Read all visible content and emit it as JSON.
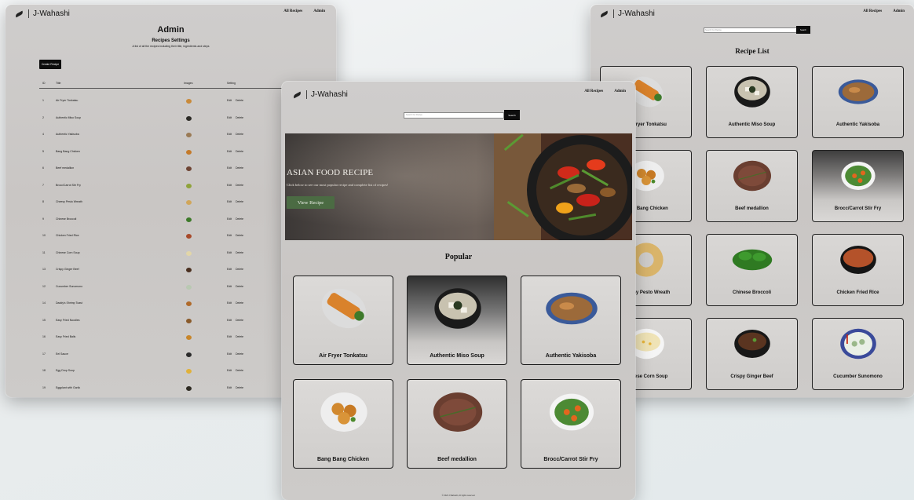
{
  "brand": "J-Wahashi",
  "nav": {
    "all_recipes": "All Recipes",
    "admin": "Admin"
  },
  "admin": {
    "title": "Admin",
    "subtitle": "Recipes Settings",
    "description": "A list of all the recipes including their title, ingredients and steps",
    "create_button": "Create Recipe",
    "columns": {
      "id": "ID",
      "title": "Title",
      "images": "Images",
      "setting": "Setting"
    },
    "edit_label": "Edit",
    "delete_label": "Delete",
    "rows": [
      {
        "id": "1",
        "title": "Air Fryer Tonkatsu",
        "thumb_color": "#c98a3a"
      },
      {
        "id": "2",
        "title": "Authentic Miso Soup",
        "thumb_color": "#2c2a26"
      },
      {
        "id": "4",
        "title": "Authentic Yakisoba",
        "thumb_color": "#9a7a55"
      },
      {
        "id": "5",
        "title": "Bang Bang Chicken",
        "thumb_color": "#c47a2a"
      },
      {
        "id": "6",
        "title": "Beef medallion",
        "thumb_color": "#6e4434"
      },
      {
        "id": "7",
        "title": "Brocc/Carrot Stir Fry",
        "thumb_color": "#8fa33a"
      },
      {
        "id": "8",
        "title": "Cheesy Pesto Wreath",
        "thumb_color": "#d1a65a"
      },
      {
        "id": "9",
        "title": "Chinese Broccoli",
        "thumb_color": "#3d7a2a"
      },
      {
        "id": "10",
        "title": "Chicken Fried Rice",
        "thumb_color": "#a84a2a"
      },
      {
        "id": "11",
        "title": "Chinese Corn Soup",
        "thumb_color": "#e2d6a8"
      },
      {
        "id": "13",
        "title": "Crispy Ginger Beef",
        "thumb_color": "#4a3020"
      },
      {
        "id": "12",
        "title": "Cucumber Sunomono",
        "thumb_color": "#b9c9b2"
      },
      {
        "id": "14",
        "title": "Daddy's Shrimp Toast",
        "thumb_color": "#b06a2a"
      },
      {
        "id": "15",
        "title": "Easy Fried Noodles",
        "thumb_color": "#8a5a2a"
      },
      {
        "id": "16",
        "title": "Easy Fried Balls",
        "thumb_color": "#c8862a"
      },
      {
        "id": "17",
        "title": "Eel Sauce",
        "thumb_color": "#2a2a2a"
      },
      {
        "id": "18",
        "title": "Egg Drop Soup",
        "thumb_color": "#e0b13a"
      },
      {
        "id": "19",
        "title": "Eggplant with Garlic",
        "thumb_color": "#2e2a22"
      }
    ]
  },
  "list": {
    "search_placeholder": "Search For Recipe",
    "search_button": "Search",
    "title": "Recipe List",
    "items": [
      {
        "name": "Air Fryer Tonkatsu"
      },
      {
        "name": "Authentic Miso Soup"
      },
      {
        "name": "Authentic Yakisoba"
      },
      {
        "name": "Bang Bang Chicken"
      },
      {
        "name": "Beef medallion"
      },
      {
        "name": "Brocc/Carrot Stir Fry"
      },
      {
        "name": "Cheesy Pesto Wreath"
      },
      {
        "name": "Chinese Broccoli"
      },
      {
        "name": "Chicken Fried Rice"
      },
      {
        "name": "Chinese Corn Soup"
      },
      {
        "name": "Crispy Ginger Beef"
      },
      {
        "name": "Cucumber Sunomono"
      }
    ]
  },
  "home": {
    "search_placeholder": "Search For Recipe",
    "search_button": "Search",
    "hero": {
      "title": "ASIAN FOOD RECIPE",
      "description": "Click below to see our most popular recipe and complete list of recipes!",
      "button": "View Recipe"
    },
    "popular_title": "Popular",
    "popular": [
      {
        "name": "Air Fryer Tonkatsu"
      },
      {
        "name": "Authentic Miso Soup"
      },
      {
        "name": "Authentic Yakisoba"
      },
      {
        "name": "Bang Bang Chicken"
      },
      {
        "name": "Beef medallion"
      },
      {
        "name": "Brocc/Carrot Stir Fry"
      }
    ],
    "footer": "© 2023 J-Wahashi, All rights reserved."
  }
}
